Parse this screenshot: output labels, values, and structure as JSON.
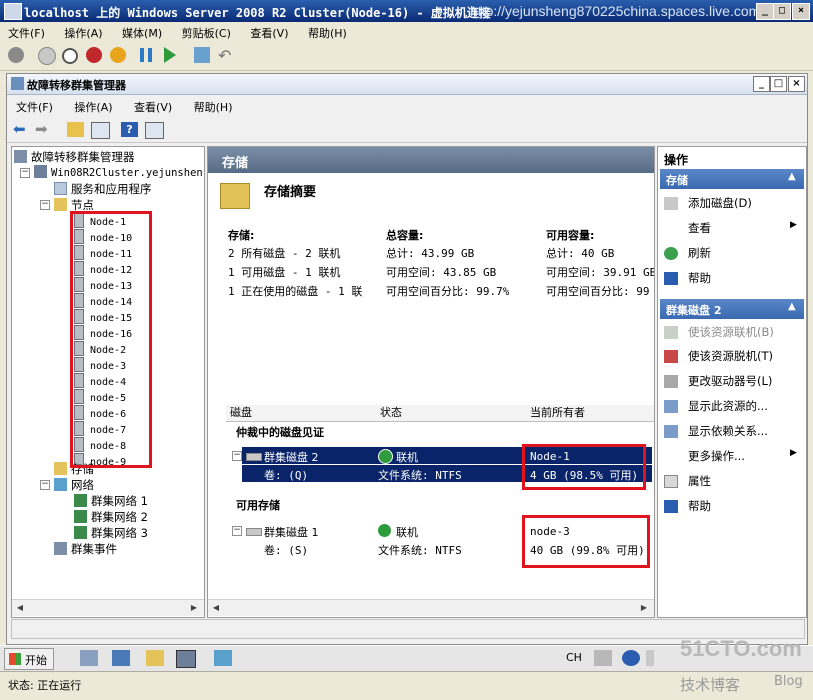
{
  "vm_window": {
    "title": "localhost 上的 Windows Server 2008 R2 Cluster(Node-16) - 虚拟机连接",
    "watermark_url": "http://yejunsheng870225china.spaces.live.com",
    "menu": [
      "文件(F)",
      "操作(A)",
      "媒体(M)",
      "剪贴板(C)",
      "查看(V)",
      "帮助(H)"
    ]
  },
  "app": {
    "title": "故障转移群集管理器",
    "menu": [
      "文件(F)",
      "操作(A)",
      "查看(V)",
      "帮助(H)"
    ]
  },
  "tree": {
    "root": "故障转移群集管理器",
    "cluster": "Win08R2Cluster.yejunshen",
    "services": "服务和应用程序",
    "nodes_label": "节点",
    "nodes": [
      "Node-1",
      "node-10",
      "node-11",
      "node-12",
      "node-13",
      "node-14",
      "node-15",
      "node-16",
      "Node-2",
      "node-3",
      "node-4",
      "node-5",
      "node-6",
      "node-7",
      "node-8",
      "node-9"
    ],
    "storage": "存储",
    "networks_label": "网络",
    "networks": [
      "群集网络 1",
      "群集网络 2",
      "群集网络 3"
    ],
    "events": "群集事件"
  },
  "center": {
    "header": "存储",
    "summary_title": "存储摘要",
    "storage_col": {
      "label": "存储:",
      "lines": [
        "2 所有磁盘 - 2 联机",
        "1 可用磁盘 - 1 联机",
        "1 正在使用的磁盘 - 1 联"
      ]
    },
    "total_col": {
      "label": "总容量:",
      "lines": [
        "总计: 43.99 GB",
        "可用空间: 43.85 GB",
        "可用空间百分比: 99.7%"
      ]
    },
    "avail_col": {
      "label": "可用容量:",
      "lines": [
        "总计: 40 GB",
        "可用空间: 39.91 GB",
        "可用空间百分比: 99"
      ]
    },
    "columns": [
      "磁盘",
      "状态",
      "当前所有者"
    ],
    "groups": [
      {
        "label": "仲裁中的磁盘见证",
        "disk": "群集磁盘 2",
        "status": "联机",
        "owner": "Node-1",
        "volume": "卷: (Q)",
        "fs": "文件系统: NTFS",
        "space": "4 GB (98.5% 可用)"
      },
      {
        "label": "可用存储",
        "disk": "群集磁盘 1",
        "status": "联机",
        "owner": "node-3",
        "volume": "卷: (S)",
        "fs": "文件系统: NTFS",
        "space": "40 GB (99.8% 可用)"
      }
    ]
  },
  "actions": {
    "header": "操作",
    "section1": "存储",
    "items1": [
      "添加磁盘(D)",
      "查看",
      "刷新",
      "帮助"
    ],
    "section2": "群集磁盘 2",
    "items2": [
      "使该资源联机(B)",
      "使该资源脱机(T)",
      "更改驱动器号(L)",
      "显示此资源的...",
      "显示依赖关系...",
      "更多操作...",
      "属性",
      "帮助"
    ]
  },
  "taskbar": {
    "start": "开始",
    "lang": "CH"
  },
  "status": {
    "text": "状态: 正在运行",
    "brand": "51CTO.com",
    "brand_sub": "技术博客",
    "brand_blog": "Blog"
  },
  "colors": {
    "highlight": "#e0141e",
    "selection": "#0a246a",
    "action_header": "#3a69b0"
  }
}
